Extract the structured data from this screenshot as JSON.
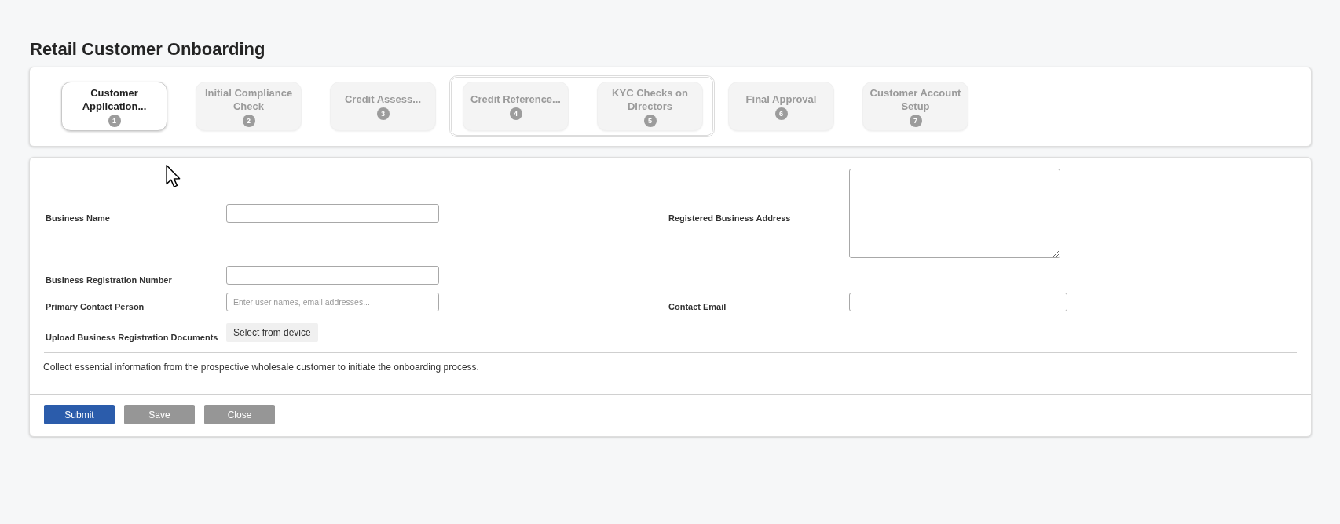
{
  "page": {
    "title": "Retail Customer Onboarding"
  },
  "stepper": {
    "steps": [
      {
        "kind": "step",
        "label": "Customer Application...",
        "number": "1",
        "selected": true
      },
      {
        "kind": "step",
        "label": "Initial Compliance Check",
        "number": "2",
        "selected": false
      },
      {
        "kind": "step",
        "label": "Credit Assess...",
        "number": "3",
        "selected": false
      },
      {
        "kind": "parallel_group",
        "steps": [
          {
            "kind": "step",
            "label": "Credit Reference...",
            "number": "4",
            "selected": false
          },
          {
            "kind": "step",
            "label": "KYC Checks on Directors",
            "number": "5",
            "selected": false
          }
        ]
      },
      {
        "kind": "step",
        "label": "Final Approval",
        "number": "6",
        "selected": false
      },
      {
        "kind": "step",
        "label": "Customer Account Setup",
        "number": "7",
        "selected": false
      }
    ]
  },
  "form": {
    "rows": [
      {
        "fields": [
          {
            "label": "Business Name",
            "kind": "text"
          },
          {
            "label": "Registered Business Address",
            "kind": "textarea"
          }
        ]
      },
      {
        "fields": [
          {
            "label": "Business Registration Number",
            "kind": "text"
          }
        ]
      },
      {
        "fields": [
          {
            "label": "Primary Contact Person",
            "kind": "people",
            "placeholder": "Enter user names, email addresses..."
          },
          {
            "label": "Contact Email",
            "kind": "text"
          }
        ]
      },
      {
        "fields": [
          {
            "label": "Upload Business Registration Documents",
            "kind": "file",
            "button": "Select from device"
          }
        ]
      }
    ],
    "description": "Collect essential information from the prospective wholesale customer to initiate the onboarding process."
  },
  "buttons": [
    {
      "label": "Submit",
      "kind": "primary"
    },
    {
      "label": "Save",
      "kind": "secondary"
    },
    {
      "label": "Close",
      "kind": "secondary"
    }
  ]
}
